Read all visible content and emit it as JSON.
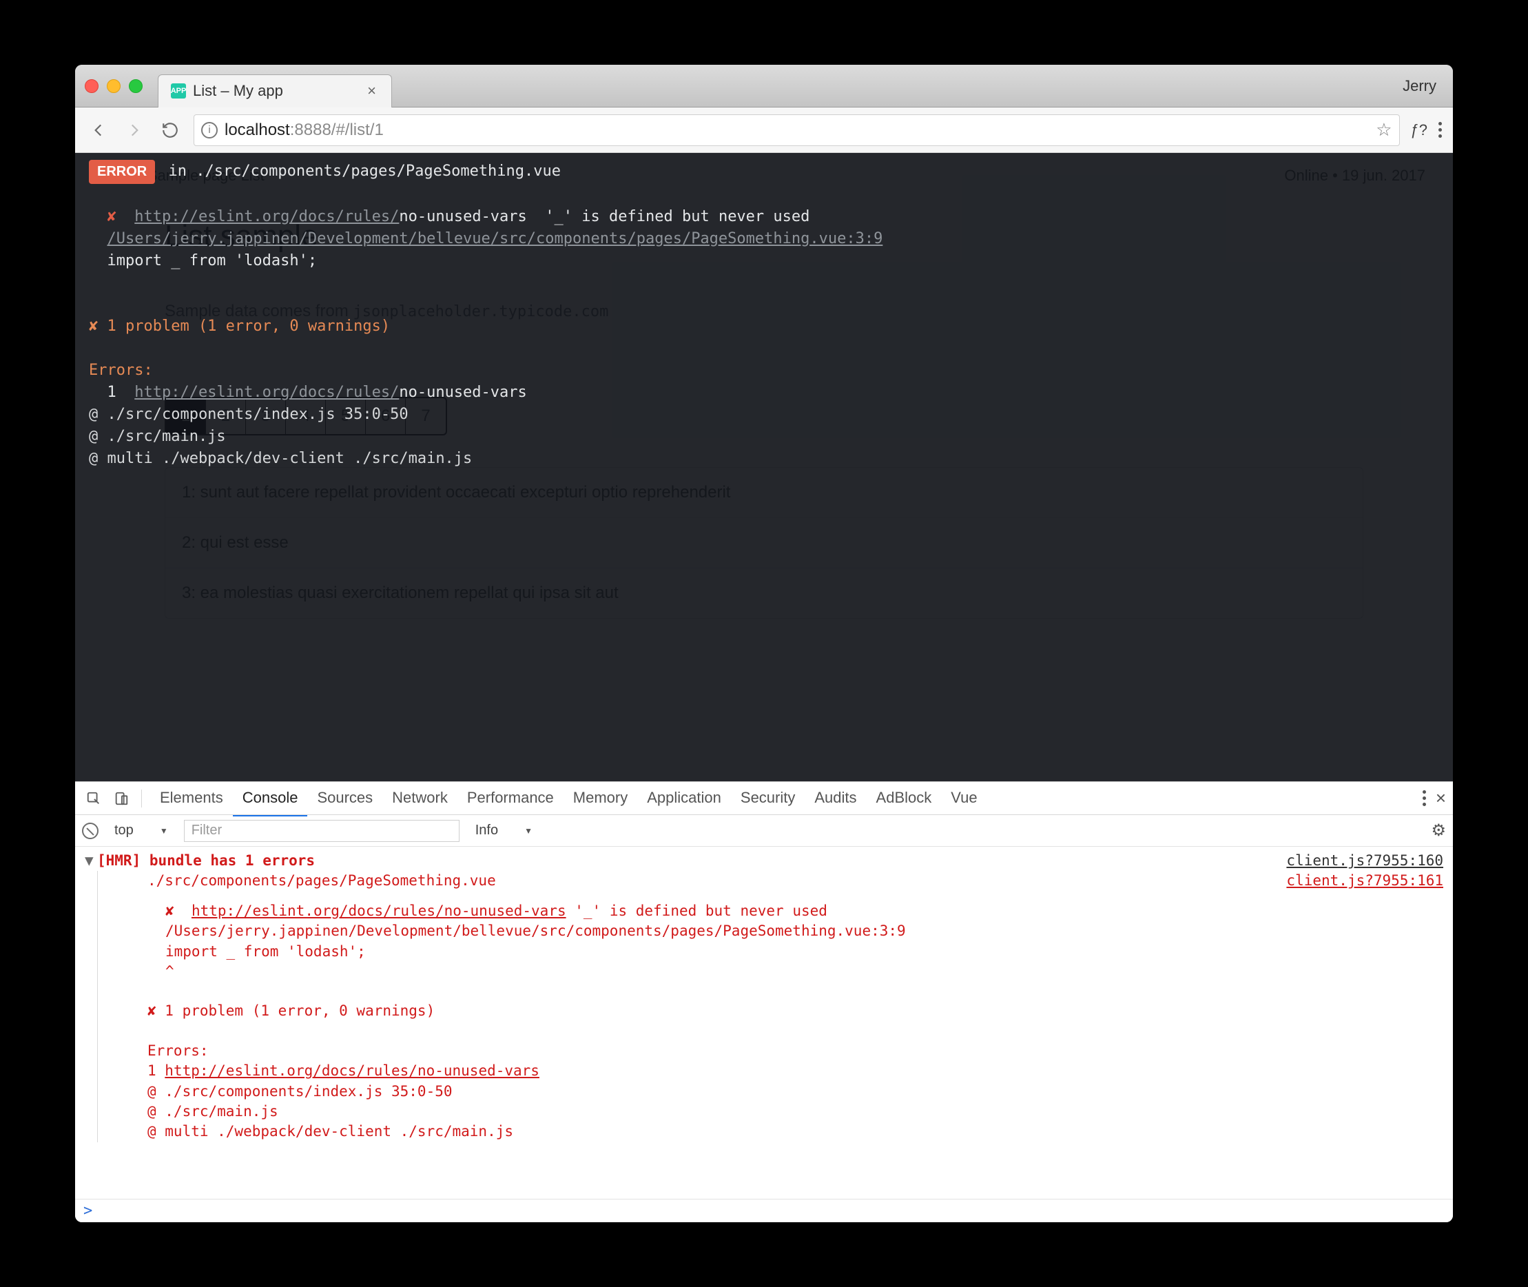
{
  "browser": {
    "tab_title": "List – My app",
    "profile": "Jerry",
    "url_host": "localhost",
    "url_port_path": ":8888/#/list/1",
    "ext_label": "ƒ?"
  },
  "page": {
    "nav_left": "Home    Sample page    List",
    "nav_right": "Online • 19 jun. 2017",
    "heading": "List sample",
    "subtitle_prefix": "Sample data comes from ",
    "subtitle_code": "jsonplaceholder.typicode.com",
    "pager": [
      "1",
      "2",
      "3",
      "4",
      "5",
      "6",
      "7"
    ],
    "pager_active_index": 0,
    "cards": [
      "1: sunt aut facere repellat provident occaecati excepturi optio reprehenderit",
      "2: qui est esse",
      "3: ea molestias quasi exercitationem repellat qui ipsa sit aut"
    ]
  },
  "overlay": {
    "badge": "ERROR",
    "in_path": " in ./src/components/pages/PageSomething.vue",
    "rule_link": "http://eslint.org/docs/rules/",
    "rule_name": "no-unused-vars",
    "rule_msg": "  '_' is defined but never used",
    "file_loc": "/Users/jerry.jappinen/Development/bellevue/src/components/pages/PageSomething.vue:3:9",
    "snippet": "import _ from 'lodash';",
    "summary": "✘ 1 problem (1 error, 0 warnings)",
    "errors_label": "Errors:",
    "err_idx": "  1  ",
    "trace": [
      "@ ./src/components/index.js 35:0-50",
      "@ ./src/main.js",
      "@ multi ./webpack/dev-client ./src/main.js"
    ]
  },
  "devtools": {
    "tabs": [
      "Elements",
      "Console",
      "Sources",
      "Network",
      "Performance",
      "Memory",
      "Application",
      "Security",
      "Audits",
      "AdBlock",
      "Vue"
    ],
    "active_tab_index": 1,
    "context": "top",
    "filter_placeholder": "Filter",
    "level": "Info",
    "hmr_header": "[HMR] bundle has 1 errors",
    "links": {
      "a": "client.js?7955:160",
      "b": "client.js?7955:161"
    },
    "lines": {
      "file": "./src/components/pages/PageSomething.vue",
      "rule_link": "http://eslint.org/docs/rules/no-unused-vars",
      "rule_msg": "  '_' is defined but never used",
      "file_loc": "/Users/jerry.jappinen/Development/bellevue/src/components/pages/PageSomething.vue:3:9",
      "snippet": "import _ from 'lodash';",
      "caret": "       ^",
      "summary": "✘ 1 problem (1 error, 0 warnings)",
      "errors_label": "Errors:",
      "err_idx": "  1  ",
      "err_link": "http://eslint.org/docs/rules/no-unused-vars",
      "trace": [
        "@ ./src/components/index.js 35:0-50",
        "@ ./src/main.js",
        "@ multi ./webpack/dev-client ./src/main.js"
      ]
    }
  }
}
